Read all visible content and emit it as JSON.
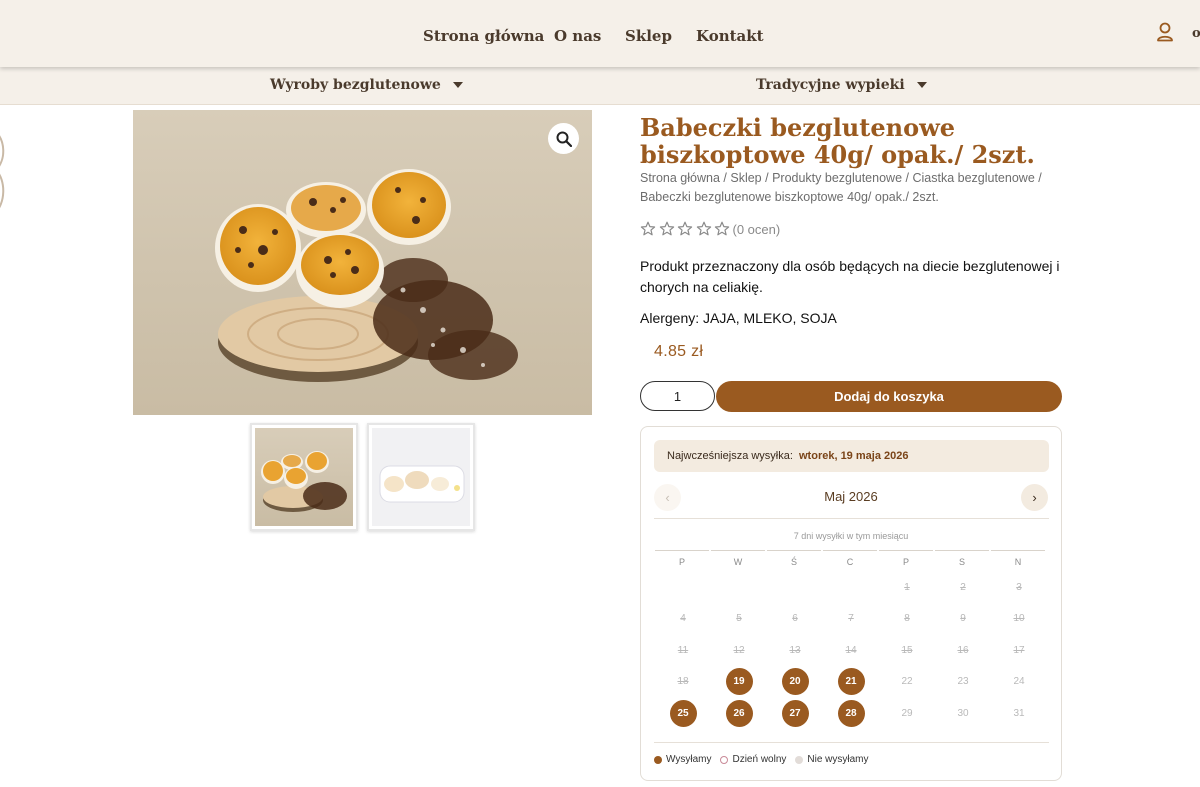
{
  "nav": {
    "items": [
      "Strona główna",
      "O nas",
      "Sklep",
      "Kontakt"
    ],
    "cut_letter": "o"
  },
  "subnav": {
    "items": [
      "Wyroby bezglutenowe",
      "Tradycyjne wypieki"
    ]
  },
  "product": {
    "title": "Babeczki bezglutenowe biszkoptowe 40g/ opak./ 2szt.",
    "breadcrumb": [
      "Strona główna",
      "Sklep",
      "Produkty bezglutenowe",
      "Ciastka bezglutenowe",
      "Babeczki bezglutenowe biszkoptowe 40g/ opak./ 2szt."
    ],
    "rating_count": "(0 ocen)",
    "rating_value": 0,
    "description": "Produkt przeznaczony dla osób będących na diecie bezglutenowej i chorych na celiakię.",
    "allergens": "Alergeny: JAJA, MLEKO, SOJA",
    "price": "4.85 zł",
    "quantity": "1",
    "add_to_cart": "Dodaj do koszyka"
  },
  "shipping": {
    "earliest_label": "Najwcześniejsza wysyłka:",
    "earliest_date": "wtorek, 19 maja 2026",
    "month": "Maj 2026",
    "prev_icon": "‹",
    "next_icon": "›",
    "subtitle": "7 dni wysyłki w tym miesiącu",
    "weekdays": [
      "P",
      "W",
      "Ś",
      "C",
      "P",
      "S",
      "N"
    ],
    "weeks": [
      [
        null,
        null,
        null,
        null,
        {
          "d": "1",
          "s": "past"
        },
        {
          "d": "2",
          "s": "past"
        },
        {
          "d": "3",
          "s": "past"
        }
      ],
      [
        {
          "d": "4",
          "s": "past"
        },
        {
          "d": "5",
          "s": "past"
        },
        {
          "d": "6",
          "s": "past"
        },
        {
          "d": "7",
          "s": "past"
        },
        {
          "d": "8",
          "s": "past"
        },
        {
          "d": "9",
          "s": "past"
        },
        {
          "d": "10",
          "s": "past"
        }
      ],
      [
        {
          "d": "11",
          "s": "past"
        },
        {
          "d": "12",
          "s": "past"
        },
        {
          "d": "13",
          "s": "past"
        },
        {
          "d": "14",
          "s": "past"
        },
        {
          "d": "15",
          "s": "past"
        },
        {
          "d": "16",
          "s": "past"
        },
        {
          "d": "17",
          "s": "past"
        }
      ],
      [
        {
          "d": "18",
          "s": "past"
        },
        {
          "d": "19",
          "s": "ship"
        },
        {
          "d": "20",
          "s": "ship"
        },
        {
          "d": "21",
          "s": "ship"
        },
        {
          "d": "22",
          "s": "plain"
        },
        {
          "d": "23",
          "s": "plain"
        },
        {
          "d": "24",
          "s": "plain"
        }
      ],
      [
        {
          "d": "25",
          "s": "ship"
        },
        {
          "d": "26",
          "s": "ship"
        },
        {
          "d": "27",
          "s": "ship"
        },
        {
          "d": "28",
          "s": "ship"
        },
        {
          "d": "29",
          "s": "plain"
        },
        {
          "d": "30",
          "s": "plain"
        },
        {
          "d": "31",
          "s": "plain"
        }
      ]
    ],
    "legend": [
      {
        "label": "Wysyłamy",
        "color": "#9a5a20"
      },
      {
        "label": "Dzień wolny",
        "color": "#f3dfe3"
      },
      {
        "label": "Nie wysyłamy",
        "color": "#e2dcd8"
      }
    ]
  },
  "colors": {
    "accent": "#9a5a20",
    "header_bg": "#f5f0e9",
    "cream": "#f3ebe0"
  },
  "icons": {
    "zoom": "magnifier-icon",
    "user": "user-icon",
    "star": "star-outline-icon"
  }
}
